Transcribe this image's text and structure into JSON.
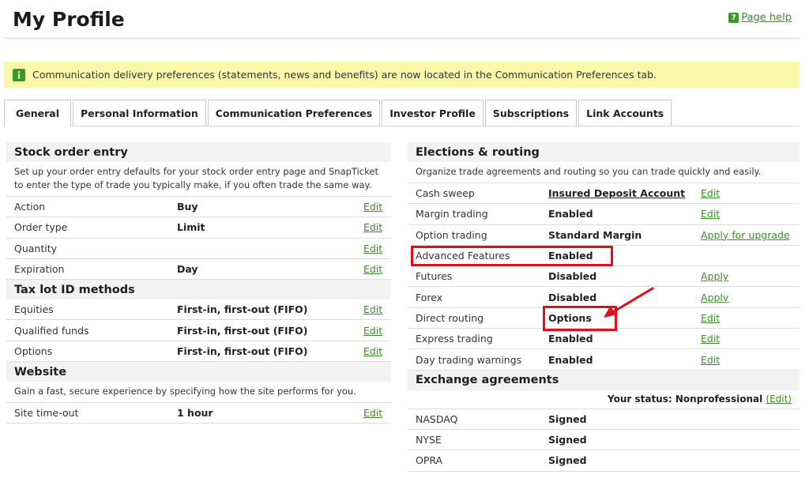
{
  "header": {
    "title": "My Profile",
    "help_label": "Page help"
  },
  "notice": {
    "text": "Communication delivery preferences (statements, news and benefits) are now located in the Communication Preferences tab."
  },
  "tabs": [
    {
      "label": "General"
    },
    {
      "label": "Personal Information"
    },
    {
      "label": "Communication Preferences"
    },
    {
      "label": "Investor Profile"
    },
    {
      "label": "Subscriptions"
    },
    {
      "label": "Link Accounts"
    }
  ],
  "stock_order": {
    "title": "Stock order entry",
    "desc": "Set up your order entry defaults for your stock order entry page and SnapTicket to enter the type of trade you typically make, if you often trade the same way.",
    "rows": [
      {
        "label": "Action",
        "value": "Buy",
        "action": "Edit"
      },
      {
        "label": "Order type",
        "value": "Limit",
        "action": "Edit"
      },
      {
        "label": "Quantity",
        "value": "",
        "action": "Edit"
      },
      {
        "label": "Expiration",
        "value": "Day",
        "action": "Edit"
      }
    ]
  },
  "tax_lot": {
    "title": "Tax lot ID methods",
    "rows": [
      {
        "label": "Equities",
        "value": "First-in, first-out (FIFO)",
        "action": "Edit"
      },
      {
        "label": "Qualified funds",
        "value": "First-in, first-out (FIFO)",
        "action": "Edit"
      },
      {
        "label": "Options",
        "value": "First-in, first-out (FIFO)",
        "action": "Edit"
      }
    ]
  },
  "website": {
    "title": "Website",
    "desc": "Gain a fast, secure experience by specifying how the site performs for you.",
    "rows": [
      {
        "label": "Site time-out",
        "value": "1 hour",
        "action": "Edit"
      }
    ]
  },
  "elections": {
    "title": "Elections & routing",
    "desc": "Organize trade agreements and routing so you can trade quickly and easily.",
    "rows": [
      {
        "label": "Cash sweep",
        "value": "Insured Deposit Account",
        "action": "Edit"
      },
      {
        "label": "Margin trading",
        "value": "Enabled",
        "action": "Edit"
      },
      {
        "label": "Option trading",
        "value": "Standard Margin",
        "action": "Apply for upgrade"
      },
      {
        "label": "Advanced Features",
        "value": "Enabled",
        "action": ""
      },
      {
        "label": "Futures",
        "value": "Disabled",
        "action": "Apply"
      },
      {
        "label": "Forex",
        "value": "Disabled",
        "action": "Apply"
      },
      {
        "label": "Direct routing",
        "value": "Options",
        "action": "Edit"
      },
      {
        "label": "Express trading",
        "value": "Enabled",
        "action": "Edit"
      },
      {
        "label": "Day trading warnings",
        "value": "Enabled",
        "action": "Edit"
      }
    ]
  },
  "exchange": {
    "title": "Exchange agreements",
    "status_label": "Your status:",
    "status_value": "Nonprofessional",
    "status_edit": "(Edit)",
    "rows": [
      {
        "label": "NASDAQ",
        "value": "Signed"
      },
      {
        "label": "NYSE",
        "value": "Signed"
      },
      {
        "label": "OPRA",
        "value": "Signed"
      }
    ]
  },
  "colors": {
    "link": "#3b8d2a",
    "notice_bg": "#fbf8a9",
    "highlight": "#e0101a",
    "icon": "#3b9a2b"
  }
}
